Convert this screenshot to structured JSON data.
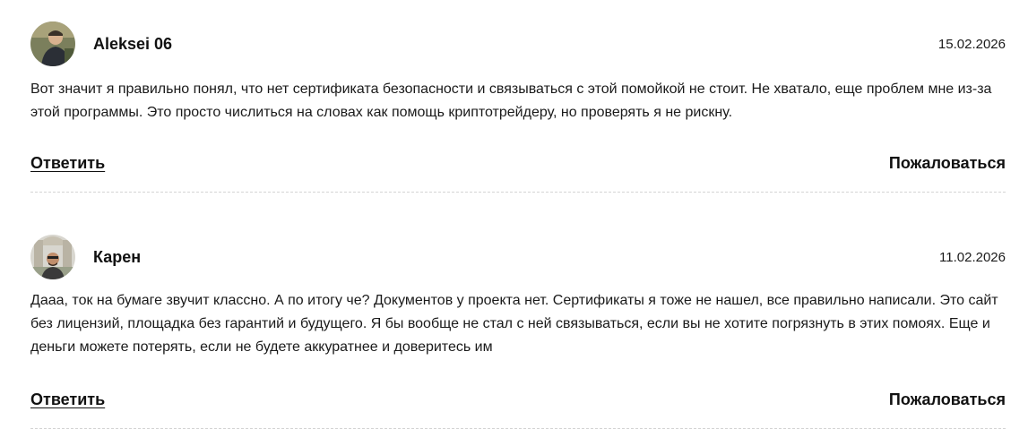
{
  "comments": [
    {
      "author": "Aleksei 06",
      "date": "15.02.2026",
      "text": "Вот значит я правильно понял, что нет сертификата безопасности и связываться с этой помойкой не стоит. Не хватало, еще проблем мне из-за этой программы. Это просто числиться на словах как помощь криптотрейдеру, но проверять я не рискну.",
      "reply_label": "Ответить",
      "report_label": "Пожаловаться"
    },
    {
      "author": "Карен",
      "date": "11.02.2026",
      "text": "Дааа, ток на бумаге звучит классно. А по итогу че? Документов у проекта нет. Сертификаты я тоже не нашел, все правильно написали. Это сайт без лицензий, площадка без гарантий и будущего. Я бы вообще не стал с ней связываться, если вы не хотите погрязнуть в этих помоях. Еще и деньги можете потерять, если не будете аккуратнее и доверитесь им",
      "reply_label": "Ответить",
      "report_label": "Пожаловаться"
    }
  ]
}
